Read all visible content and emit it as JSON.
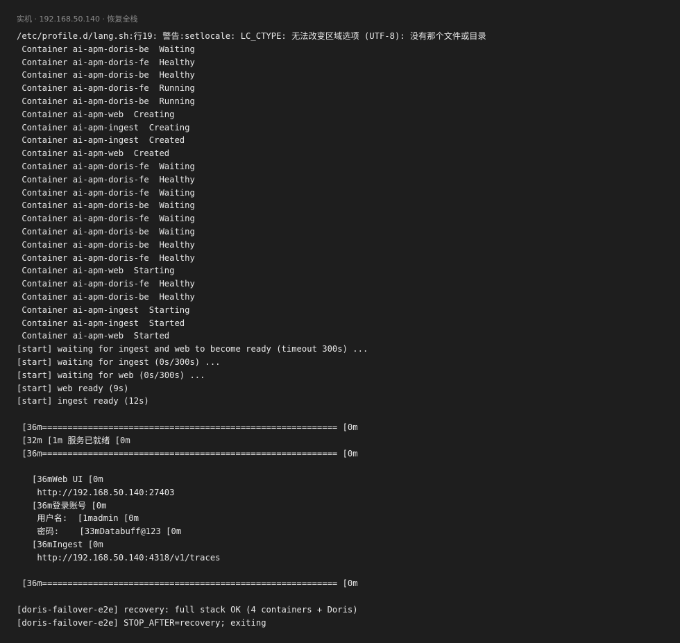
{
  "header": {
    "title": "实机 · 192.168.50.140 · 恢复全栈"
  },
  "terminal": {
    "lines": [
      "/etc/profile.d/lang.sh:行19: 警告:setlocale: LC_CTYPE: 无法改变区域选项 (UTF-8): 没有那个文件或目录",
      " Container ai-apm-doris-be  Waiting",
      " Container ai-apm-doris-fe  Healthy",
      " Container ai-apm-doris-be  Healthy",
      " Container ai-apm-doris-fe  Running",
      " Container ai-apm-doris-be  Running",
      " Container ai-apm-web  Creating",
      " Container ai-apm-ingest  Creating",
      " Container ai-apm-ingest  Created",
      " Container ai-apm-web  Created",
      " Container ai-apm-doris-fe  Waiting",
      " Container ai-apm-doris-fe  Healthy",
      " Container ai-apm-doris-fe  Waiting",
      " Container ai-apm-doris-be  Waiting",
      " Container ai-apm-doris-fe  Waiting",
      " Container ai-apm-doris-be  Waiting",
      " Container ai-apm-doris-be  Healthy",
      " Container ai-apm-doris-fe  Healthy",
      " Container ai-apm-web  Starting",
      " Container ai-apm-doris-fe  Healthy",
      " Container ai-apm-doris-be  Healthy",
      " Container ai-apm-ingest  Starting",
      " Container ai-apm-ingest  Started",
      " Container ai-apm-web  Started",
      "[start] waiting for ingest and web to become ready (timeout 300s) ...",
      "[start] waiting for ingest (0s/300s) ...",
      "[start] waiting for web (0s/300s) ...",
      "[start] web ready (9s)",
      "[start] ingest ready (12s)",
      "",
      " [36m========================================================== [0m",
      " [32m [1m 服务已就绪 [0m",
      " [36m========================================================== [0m",
      "",
      "   [36mWeb UI [0m",
      "    http://192.168.50.140:27403",
      "   [36m登录账号 [0m",
      "    用户名:  [1madmin [0m",
      "    密码:    [33mDatabuff@123 [0m",
      "   [36mIngest [0m",
      "    http://192.168.50.140:4318/v1/traces",
      "",
      " [36m========================================================== [0m",
      "",
      "[doris-failover-e2e] recovery: full stack OK (4 containers + Doris)",
      "[doris-failover-e2e] STOP_AFTER=recovery; exiting"
    ]
  }
}
